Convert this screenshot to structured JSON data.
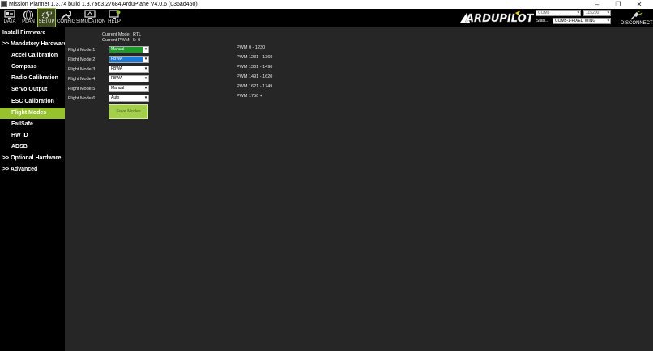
{
  "window": {
    "title": "Mission Planner 1.3.74 build 1.3.7563.27684 ArduPlane V4.0.6 (036ad450)",
    "minimize": "–",
    "maximize": "❐",
    "close": "✕"
  },
  "toolbar": {
    "buttons": [
      {
        "label": "DATA",
        "icon": "monitor-icon"
      },
      {
        "label": "PLAN",
        "icon": "globe-icon"
      },
      {
        "label": "SETUP",
        "icon": "gears-icon"
      },
      {
        "label": "CONFIG",
        "icon": "wrench-icon"
      },
      {
        "label": "SIMULATION",
        "icon": "sim-icon"
      },
      {
        "label": "HELP",
        "icon": "help-icon"
      }
    ],
    "active": "SETUP",
    "logo_text": "ARDUPILOT",
    "port": "COM5",
    "baud": "115200",
    "stats_label": "Stats...",
    "vehicle": "COM5-1-FIXED WING",
    "disconnect_label": "DISCONNECT"
  },
  "sidebar": {
    "items": [
      {
        "label": "Install Firmware"
      },
      {
        "label": ">> Mandatory Hardware"
      },
      {
        "label": "Accel Calibration"
      },
      {
        "label": "Compass"
      },
      {
        "label": "Radio Calibration"
      },
      {
        "label": "Servo Output"
      },
      {
        "label": "ESC Calibration"
      },
      {
        "label": "Flight Modes"
      },
      {
        "label": "FailSafe"
      },
      {
        "label": "HW ID"
      },
      {
        "label": "ADSB"
      },
      {
        "label": ">> Optional Hardware"
      },
      {
        "label": ">> Advanced"
      }
    ],
    "active": "Flight Modes"
  },
  "flight_modes": {
    "current_mode_label": "Current Mode:",
    "current_mode_value": "RTL",
    "current_pwm_label": "Current PWM:",
    "current_pwm_value": "5: 0",
    "modes": [
      {
        "label": "Flight Mode 1",
        "value": "Manual",
        "pwm": "PWM 0 - 1230"
      },
      {
        "label": "Flight Mode 2",
        "value": "FBWA",
        "pwm": "PWM 1231 - 1360"
      },
      {
        "label": "Flight Mode 3",
        "value": "FBWA",
        "pwm": "PWM 1361 - 1490"
      },
      {
        "label": "Flight Mode 4",
        "value": "FBWA",
        "pwm": "PWM 1491 - 1620"
      },
      {
        "label": "Flight Mode 5",
        "value": "Manual",
        "pwm": "PWM 1621 - 1749"
      },
      {
        "label": "Flight Mode 6",
        "value": "Auto",
        "pwm": "PWM 1750 +"
      }
    ],
    "save_label": "Save Modes"
  },
  "colors": {
    "accent": "#97c22e",
    "active_mode": "#1e9a2a",
    "selected": "#1f7ad6"
  }
}
